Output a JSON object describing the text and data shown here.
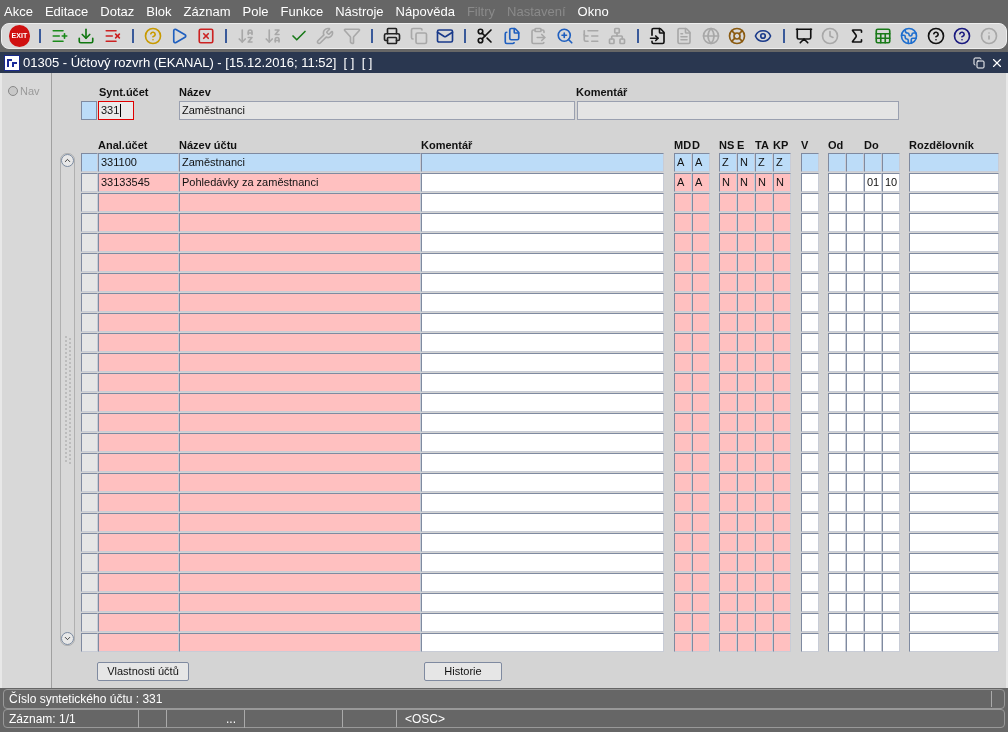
{
  "menu": [
    {
      "label": "Akce",
      "disabled": false
    },
    {
      "label": "Editace",
      "disabled": false
    },
    {
      "label": "Dotaz",
      "disabled": false
    },
    {
      "label": "Blok",
      "disabled": false
    },
    {
      "label": "Záznam",
      "disabled": false
    },
    {
      "label": "Pole",
      "disabled": false
    },
    {
      "label": "Funkce",
      "disabled": false
    },
    {
      "label": "Nástroje",
      "disabled": false
    },
    {
      "label": "Nápověda",
      "disabled": false
    },
    {
      "label": "Filtry",
      "disabled": true
    },
    {
      "label": "Nastavení",
      "disabled": true
    },
    {
      "label": "Okno",
      "disabled": false
    }
  ],
  "toolbar": [
    {
      "kind": "exit",
      "label": "EXIT",
      "disabled": false
    },
    {
      "kind": "separator"
    },
    {
      "kind": "insert",
      "disabled": false
    },
    {
      "kind": "fetch",
      "disabled": false
    },
    {
      "kind": "remove",
      "disabled": false
    },
    {
      "kind": "separator"
    },
    {
      "kind": "query",
      "disabled": false
    },
    {
      "kind": "execute",
      "disabled": false
    },
    {
      "kind": "cancel",
      "disabled": false
    },
    {
      "kind": "separator"
    },
    {
      "kind": "sort-asc",
      "disabled": true
    },
    {
      "kind": "sort-desc",
      "disabled": true
    },
    {
      "kind": "check",
      "disabled": false
    },
    {
      "kind": "wrench",
      "disabled": true
    },
    {
      "kind": "filter",
      "disabled": true
    },
    {
      "kind": "separator"
    },
    {
      "kind": "print",
      "disabled": false
    },
    {
      "kind": "copies",
      "disabled": true
    },
    {
      "kind": "mail",
      "disabled": false
    },
    {
      "kind": "separator"
    },
    {
      "kind": "scissors",
      "disabled": false
    },
    {
      "kind": "copy",
      "disabled": false
    },
    {
      "kind": "paste",
      "disabled": true
    },
    {
      "kind": "zoom",
      "disabled": false
    },
    {
      "kind": "indent",
      "disabled": true
    },
    {
      "kind": "tree",
      "disabled": true
    },
    {
      "kind": "separator"
    },
    {
      "kind": "import",
      "disabled": false
    },
    {
      "kind": "document",
      "disabled": true
    },
    {
      "kind": "globe",
      "disabled": true
    },
    {
      "kind": "wheel",
      "disabled": false
    },
    {
      "kind": "eye",
      "disabled": false
    },
    {
      "kind": "separator"
    },
    {
      "kind": "chart",
      "disabled": false
    },
    {
      "kind": "clock",
      "disabled": true
    },
    {
      "kind": "sigma",
      "disabled": false
    },
    {
      "kind": "sheet",
      "disabled": false
    },
    {
      "kind": "browser",
      "disabled": false
    },
    {
      "kind": "help-bars",
      "disabled": false
    },
    {
      "kind": "help",
      "disabled": false
    },
    {
      "kind": "info",
      "disabled": true
    }
  ],
  "window": {
    "title": "01305 - Účtový rozvrh (EKANAL) - [15.12.2016; 11:52]  [ ]  [ ]"
  },
  "nav": {
    "label": "Nav",
    "selected": false
  },
  "header": {
    "synt_label": "Synt.účet",
    "synt_value": "331",
    "nazev_label": "Název",
    "nazev_value": "Zaměstnanci",
    "komentar_label": "Komentář"
  },
  "table": {
    "columns": [
      {
        "label": "Anal.účet",
        "required": true
      },
      {
        "label": "Název účtu",
        "required": true
      },
      {
        "label": "Komentář",
        "required": false
      },
      {
        "label": "MD",
        "required": true
      },
      {
        "label": "D",
        "required": true
      },
      {
        "label": "NS",
        "required": true
      },
      {
        "label": "E",
        "required": true
      },
      {
        "label": "TA",
        "required": true
      },
      {
        "label": "KP",
        "required": true
      },
      {
        "label": "V",
        "required": false
      },
      {
        "label": "Od",
        "required": false
      },
      {
        "required": false
      },
      {
        "label": "Do",
        "required": false
      },
      {
        "required": false
      },
      {
        "label": "Rozdělovník",
        "required": false
      }
    ],
    "rows": [
      {
        "selected": true,
        "cells": [
          "331100",
          "Zaměstnanci",
          null,
          "A",
          "A",
          "Z",
          "N",
          "Z",
          "Z",
          null,
          null,
          null,
          null,
          null,
          null
        ]
      },
      {
        "selected": false,
        "cells": [
          "33133545",
          "Pohledávky za zaměstnanci",
          null,
          "A",
          "A",
          "N",
          "N",
          "N",
          "N",
          null,
          null,
          null,
          "01",
          "10",
          null
        ]
      },
      {
        "selected": false
      },
      {
        "selected": false
      },
      {
        "selected": false
      },
      {
        "selected": false
      },
      {
        "selected": false
      },
      {
        "selected": false
      },
      {
        "selected": false
      },
      {
        "selected": false
      },
      {
        "selected": false
      },
      {
        "selected": false
      },
      {
        "selected": false
      },
      {
        "selected": false
      },
      {
        "selected": false
      },
      {
        "selected": false
      },
      {
        "selected": false
      },
      {
        "selected": false
      },
      {
        "selected": false
      },
      {
        "selected": false
      },
      {
        "selected": false
      },
      {
        "selected": false
      },
      {
        "selected": false
      },
      {
        "selected": false
      },
      {
        "selected": false
      }
    ]
  },
  "buttons": [
    "Vlastnosti účtů",
    "Historie"
  ],
  "status_bar": {
    "message": "Číslo syntetického účtu : 331",
    "record": "Záznam: 1/1",
    "ellipsis": "...",
    "mode": "<OSC>"
  }
}
